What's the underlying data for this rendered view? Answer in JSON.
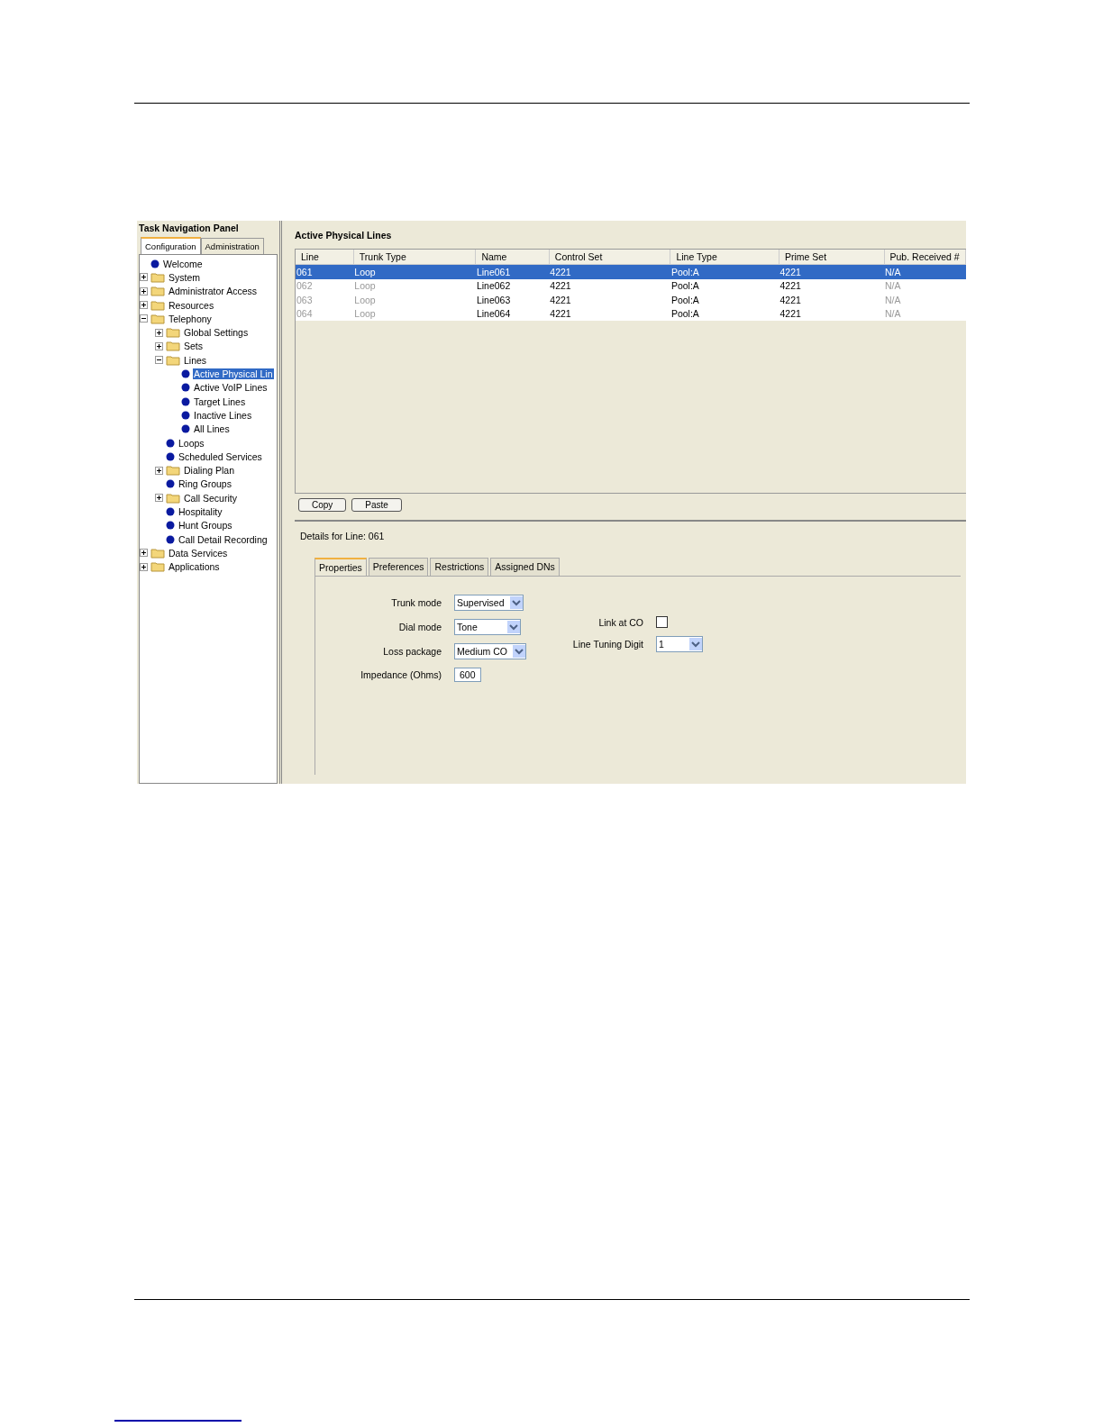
{
  "nav_panel": {
    "title": "Task Navigation Panel",
    "tabs": [
      {
        "label": "Configuration",
        "selected": true
      },
      {
        "label": "Administration",
        "selected": false
      }
    ],
    "tree": [
      {
        "label": "Welcome",
        "kind": "leaf",
        "selected": false
      },
      {
        "label": "System",
        "kind": "folder",
        "expanded": false,
        "selected": false
      },
      {
        "label": "Administrator Access",
        "kind": "folder",
        "expanded": false,
        "selected": false
      },
      {
        "label": "Resources",
        "kind": "folder",
        "expanded": false,
        "selected": false
      },
      {
        "label": "Telephony",
        "kind": "folder",
        "expanded": true,
        "selected": false,
        "children": [
          {
            "label": "Global Settings",
            "kind": "folder",
            "expanded": false,
            "selected": false
          },
          {
            "label": "Sets",
            "kind": "folder",
            "expanded": false,
            "selected": false
          },
          {
            "label": "Lines",
            "kind": "folder",
            "expanded": true,
            "selected": false,
            "children": [
              {
                "label": "Active Physical Lin",
                "kind": "leaf",
                "selected": true
              },
              {
                "label": "Active VoIP Lines",
                "kind": "leaf",
                "selected": false
              },
              {
                "label": "Target Lines",
                "kind": "leaf",
                "selected": false
              },
              {
                "label": "Inactive Lines",
                "kind": "leaf",
                "selected": false
              },
              {
                "label": "All Lines",
                "kind": "leaf",
                "selected": false
              }
            ]
          },
          {
            "label": "Loops",
            "kind": "leaf",
            "selected": false
          },
          {
            "label": "Scheduled Services",
            "kind": "leaf",
            "selected": false
          },
          {
            "label": "Dialing Plan",
            "kind": "folder",
            "expanded": false,
            "selected": false
          },
          {
            "label": "Ring Groups",
            "kind": "leaf",
            "selected": false
          },
          {
            "label": "Call Security",
            "kind": "folder",
            "expanded": false,
            "selected": false
          },
          {
            "label": "Hospitality",
            "kind": "leaf",
            "selected": false
          },
          {
            "label": "Hunt Groups",
            "kind": "leaf",
            "selected": false
          },
          {
            "label": "Call Detail Recording",
            "kind": "leaf",
            "selected": false
          }
        ]
      },
      {
        "label": "Data Services",
        "kind": "folder",
        "expanded": false,
        "selected": false
      },
      {
        "label": "Applications",
        "kind": "folder",
        "expanded": false,
        "selected": false
      }
    ]
  },
  "main": {
    "title": "Active Physical Lines",
    "table": {
      "columns": [
        {
          "label": "Line",
          "muted": true
        },
        {
          "label": "Trunk Type",
          "muted": true
        },
        {
          "label": "Name",
          "muted": false
        },
        {
          "label": "Control Set",
          "muted": false
        },
        {
          "label": "Line Type",
          "muted": false
        },
        {
          "label": "Prime Set",
          "muted": false
        },
        {
          "label": "Pub. Received #",
          "muted": true
        }
      ],
      "rows": [
        {
          "selected": true,
          "cells": [
            "061",
            "Loop",
            "Line061",
            "4221",
            "Pool:A",
            "4221",
            "N/A"
          ]
        },
        {
          "selected": false,
          "cells": [
            "062",
            "Loop",
            "Line062",
            "4221",
            "Pool:A",
            "4221",
            "N/A"
          ]
        },
        {
          "selected": false,
          "cells": [
            "063",
            "Loop",
            "Line063",
            "4221",
            "Pool:A",
            "4221",
            "N/A"
          ]
        },
        {
          "selected": false,
          "cells": [
            "064",
            "Loop",
            "Line064",
            "4221",
            "Pool:A",
            "4221",
            "N/A"
          ]
        }
      ]
    },
    "buttons": [
      "Copy",
      "Paste"
    ],
    "details": {
      "title": "Details for Line: 061",
      "tabs": [
        {
          "label": "Properties",
          "selected": true
        },
        {
          "label": "Preferences",
          "selected": false
        },
        {
          "label": "Restrictions",
          "selected": false
        },
        {
          "label": "Assigned DNs",
          "selected": false
        }
      ],
      "left_fields": [
        {
          "label": "Trunk mode",
          "kind": "select",
          "value": "Supervised"
        },
        {
          "label": "Dial mode",
          "kind": "select",
          "value": "Tone"
        },
        {
          "label": "Loss package",
          "kind": "select",
          "value": "Medium CO"
        },
        {
          "label": "Impedance (Ohms)",
          "kind": "text",
          "value": "600"
        }
      ],
      "right_fields": [
        {
          "label": "Link at CO",
          "kind": "checkbox",
          "checked": false
        },
        {
          "label": "Line Tuning Digit",
          "kind": "select",
          "value": "1"
        }
      ]
    }
  }
}
